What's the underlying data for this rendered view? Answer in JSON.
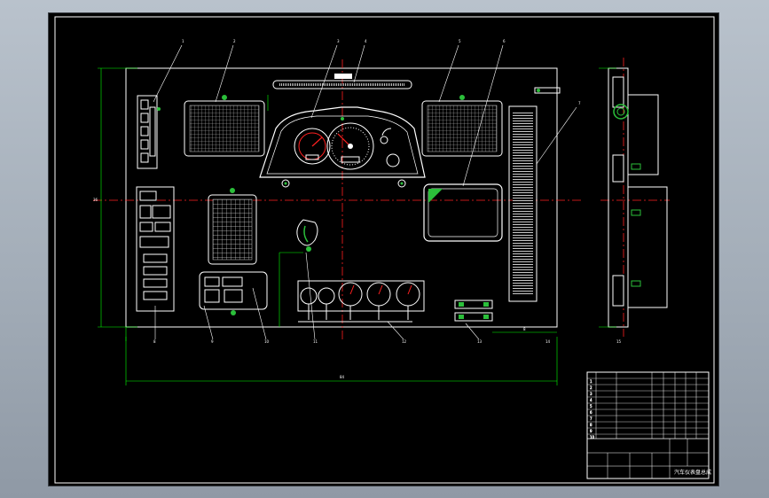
{
  "colors": {
    "background_desktop": "#a8b1bc",
    "sheet": "#000000",
    "outline": "#ffffff",
    "dimension": "#00ff00",
    "centerline": "#ff2020",
    "accent_green": "#2bbf3a",
    "hatch": "#c8c8c8"
  },
  "drawing": {
    "callout_numbers": [
      "1",
      "2",
      "3",
      "4",
      "5",
      "6",
      "7",
      "8",
      "9",
      "10",
      "11",
      "12",
      "13",
      "14",
      "15"
    ],
    "dimension_labels": {
      "overall_width": "84",
      "overall_height": "36",
      "right_offset": "8"
    }
  },
  "title_block": {
    "drawing_title": "汽车仪表盘总成",
    "parts_rows": [
      "1",
      "2",
      "3",
      "4",
      "5",
      "6",
      "7",
      "8",
      "9",
      "10"
    ]
  }
}
